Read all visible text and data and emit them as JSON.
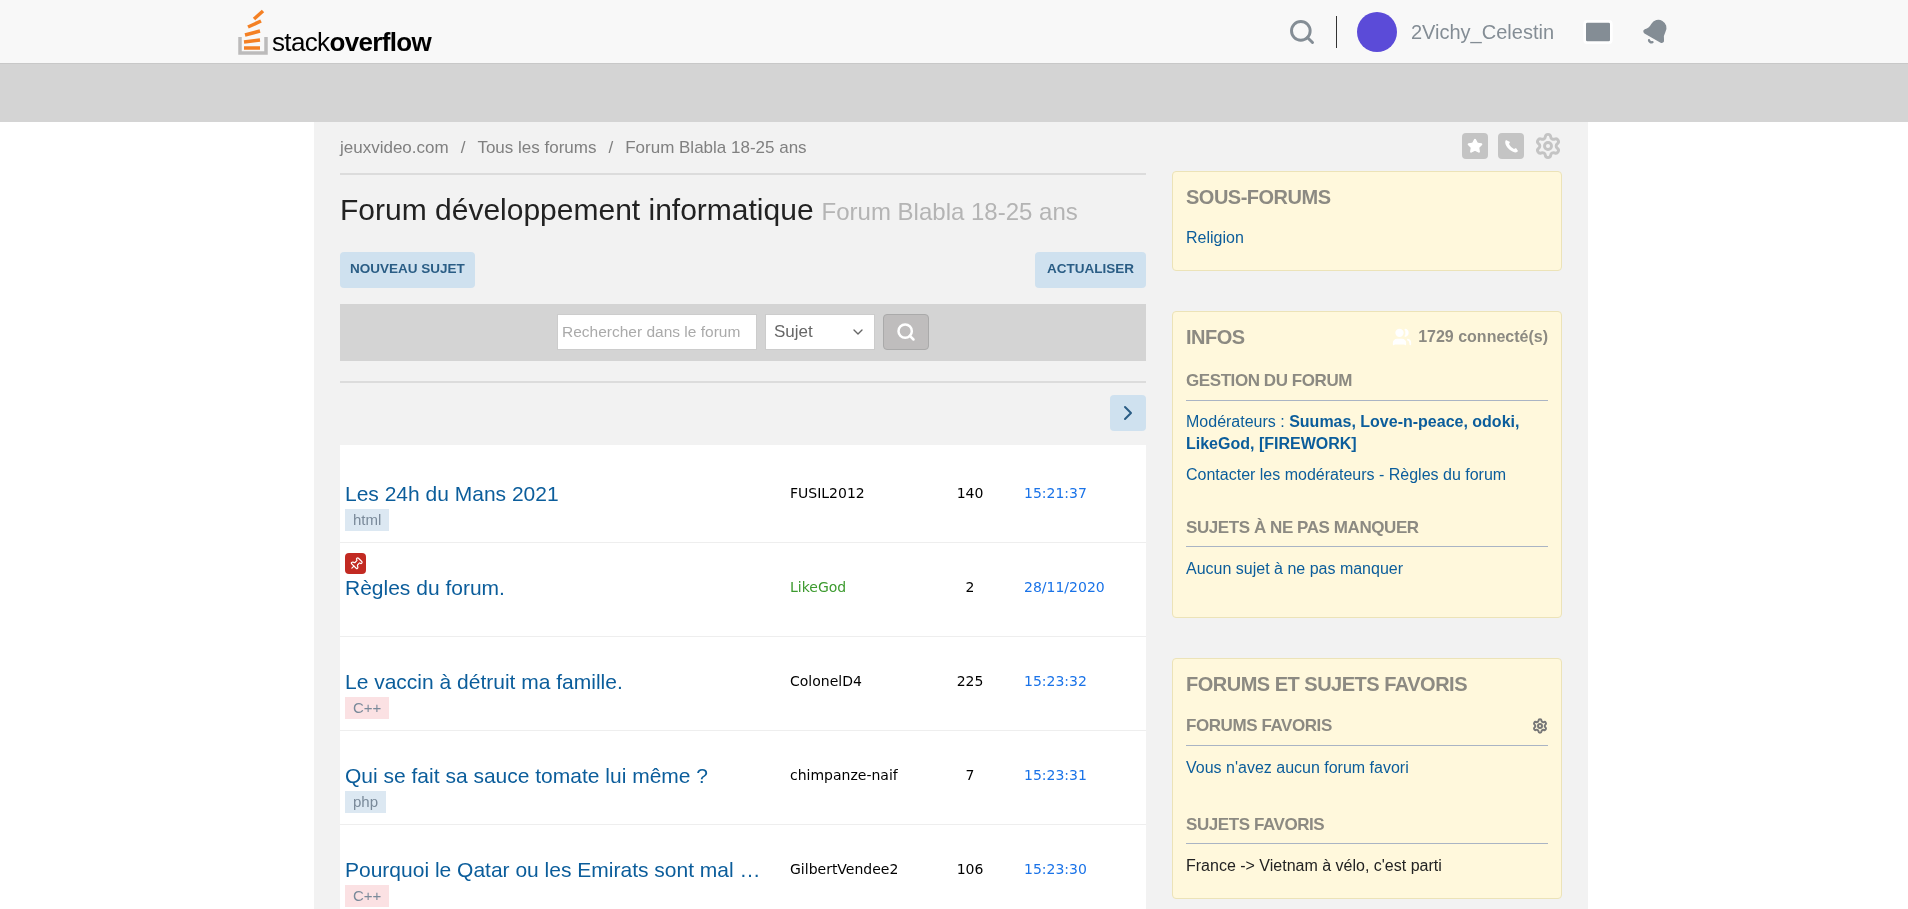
{
  "header": {
    "logo": "stack**overflow**",
    "username": "2Vichy_Celestin"
  },
  "breadcrumb": [
    {
      "label": "jeuxvideo.com"
    },
    {
      "separator": "/",
      "label": "Tous les forums"
    },
    {
      "separator": "/",
      "label": "Forum Blabla 18-25 ans"
    }
  ],
  "title": "Forum développement informatique",
  "subtitle": "Forum Blabla 18-25 ans",
  "buttons": {
    "new_topic": "NOUVEAU SUJET",
    "refresh": "ACTUALISER"
  },
  "search": {
    "placeholder": "Rechercher dans le forum",
    "scope": "Sujet"
  },
  "topics": [
    {
      "title": "Les 24h du Mans 2021",
      "pinned": false,
      "tag": {
        "label": "html",
        "color": "#dce8f2"
      },
      "author": "FUSIL2012",
      "moderator": false,
      "replies": "140",
      "last": "15:21:37"
    },
    {
      "title": "Règles du forum.",
      "pinned": true,
      "author": "LikeGod",
      "moderator": true,
      "replies": "2",
      "last": "28/11/2020"
    },
    {
      "title": "Le vaccin à détruit ma famille.",
      "pinned": false,
      "tag": {
        "label": "C++",
        "color": "#fbe1e3"
      },
      "author": "ColonelD4",
      "moderator": false,
      "replies": "225",
      "last": "15:23:32"
    },
    {
      "title": "Qui se fait sa sauce tomate lui même ?",
      "pinned": false,
      "tag": {
        "label": "php",
        "color": "#dce8f2"
      },
      "author": "chimpanze-naif",
      "moderator": false,
      "replies": "7",
      "last": "15:23:31"
    },
    {
      "title": "Pourquoi le Qatar ou les Emirats sont mal …",
      "pinned": false,
      "tag": {
        "label": "C++",
        "color": "#fbe1e3"
      },
      "author": "GilbertVendee2",
      "moderator": false,
      "replies": "106",
      "last": "15:23:30"
    }
  ],
  "sidebar": {
    "subforums": {
      "heading": "SOUS-FORUMS",
      "items": [
        "Religion"
      ]
    },
    "infos": {
      "heading": "INFOS",
      "online": "1729 connecté(s)",
      "management_heading": "GESTION DU FORUM",
      "moderators": "Modérateurs : **Suumas, Love-n-peace, odoki, LikeGod, [FIREWORK]**",
      "contact": "Contacter les modérateurs - Règles du forum",
      "must_read_heading": "SUJETS À NE PAS MANQUER",
      "must_read": "Aucun sujet à ne pas manquer"
    },
    "favorites": {
      "heading": "FORUMS ET SUJETS FAVORIS",
      "forums_heading": "FORUMS FAVORIS",
      "forums_empty": "Vous n'avez aucun forum favori",
      "topics_heading": "SUJETS FAVORIS",
      "topics": [
        "France -> Vietnam à vélo, c'est parti"
      ]
    }
  }
}
